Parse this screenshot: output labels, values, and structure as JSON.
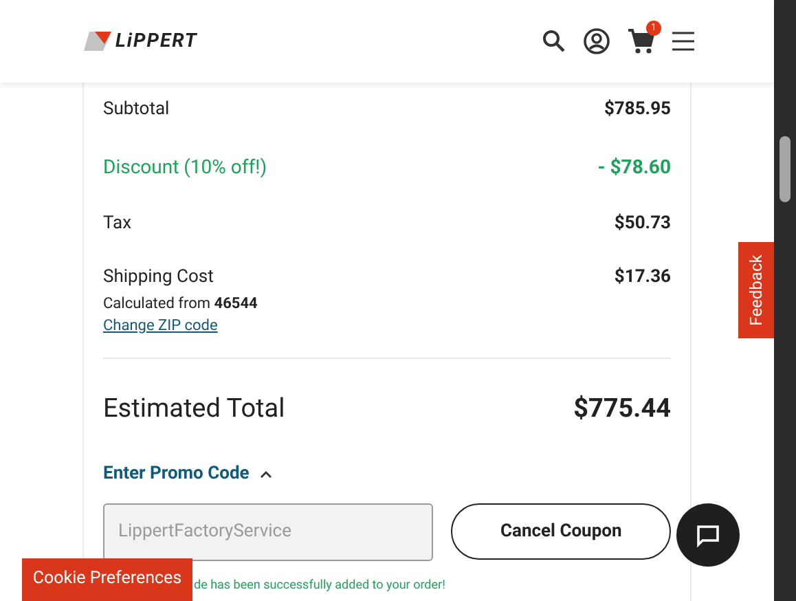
{
  "header": {
    "logo_text": "LiPPERT",
    "cart_count": "1"
  },
  "summary": [
    {
      "kind": "plain",
      "label": "Subtotal",
      "value": "$785.95"
    },
    {
      "kind": "discount",
      "label": "Discount (10% off!)",
      "value": "- $78.60"
    },
    {
      "kind": "plain",
      "label": "Tax",
      "value": "$50.73"
    },
    {
      "kind": "shipping",
      "label": "Shipping Cost",
      "value": "$17.36",
      "note_prefix": "Calculated from",
      "zip": "46544",
      "link": "Change ZIP code"
    }
  ],
  "total": {
    "label": "Estimated Total",
    "value": "$775.44"
  },
  "promo": {
    "toggle": "Enter Promo Code",
    "expanded": true,
    "value": "LippertFactoryService",
    "disabled": true,
    "button": "Cancel Coupon",
    "message": "de has been successfully added to your order!"
  },
  "feedback": "Feedback",
  "cookie_button": "Cookie Preferences"
}
